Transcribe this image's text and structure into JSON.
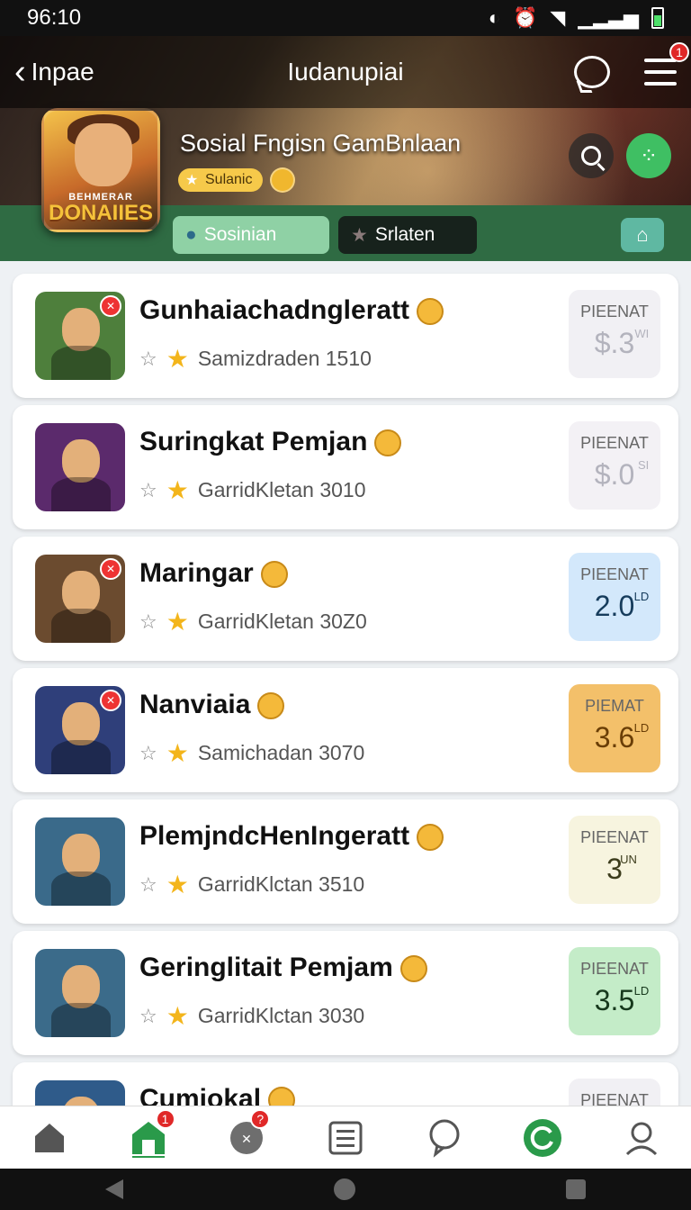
{
  "status": {
    "time": "96:10"
  },
  "nav": {
    "back_label": "Inpae",
    "title": "Iudanupiai",
    "menu_badge": "1"
  },
  "app": {
    "name": "Sosial Fngisn GamBnlaan",
    "icon_top": "BEHMERAR",
    "icon_logo": "DONAIIES",
    "chip": "Sulanic"
  },
  "tabs": [
    {
      "label": "Sosinian",
      "active": true
    },
    {
      "label": "Srlaten",
      "active": false
    }
  ],
  "items": [
    {
      "title": "Gunhaiachadngleratt",
      "subtitle": "Samizdraden 1510",
      "price_label": "PIEENAT",
      "price": "$.3",
      "price_sup": "WI",
      "price_bg": "#f1f0f4",
      "price_fg": "#b3b3bd",
      "thumb_bg": "#4e7f3c",
      "thumb_badge": true
    },
    {
      "title": "Suringkat Pemjan",
      "subtitle": "GarridKletan 3010",
      "price_label": "PIEENAT",
      "price": "$.0",
      "price_sup": "SI",
      "price_bg": "#f3f1f5",
      "price_fg": "#b3b3bd",
      "thumb_bg": "#5b2a6c",
      "thumb_badge": false
    },
    {
      "title": "Maringar",
      "subtitle": "GarridKletan 30Z0",
      "price_label": "PIEENAT",
      "price": "2.0",
      "price_sup": "LD",
      "price_bg": "#d3e8fb",
      "price_fg": "#163c5c",
      "thumb_bg": "#6b4b2f",
      "thumb_badge": true
    },
    {
      "title": "Nanviaia",
      "subtitle": "Samichadan 3070",
      "price_label": "PIEMAT",
      "price": "3.6",
      "price_sup": "LD",
      "price_bg": "#f3c06a",
      "price_fg": "#6a3e06",
      "thumb_bg": "#2f3f7a",
      "thumb_badge": true
    },
    {
      "title": "PlemjndcHenIngeratt",
      "subtitle": "GarridKlctan 3510",
      "price_label": "PIEENAT",
      "price": "3",
      "price_sup": "UN",
      "price_bg": "#f7f4df",
      "price_fg": "#3c3c1c",
      "thumb_bg": "#3a6a8a",
      "thumb_badge": false
    },
    {
      "title": "Geringlitait Pemjam",
      "subtitle": "GarridKlctan 3030",
      "price_label": "PIEENAT",
      "price": "3.5",
      "price_sup": "LD",
      "price_bg": "#c4ecc8",
      "price_fg": "#16381c",
      "thumb_bg": "#3b6b8a",
      "thumb_badge": false
    },
    {
      "title": "Cumiokal",
      "subtitle": "",
      "price_label": "PIEENAT",
      "price": "",
      "price_sup": "",
      "price_bg": "#f1f0f4",
      "price_fg": "#b3b3bd",
      "thumb_bg": "#2f5b8a",
      "thumb_badge": false
    }
  ],
  "bottom_nav": {
    "badge_home": "1",
    "badge_games": "?"
  }
}
